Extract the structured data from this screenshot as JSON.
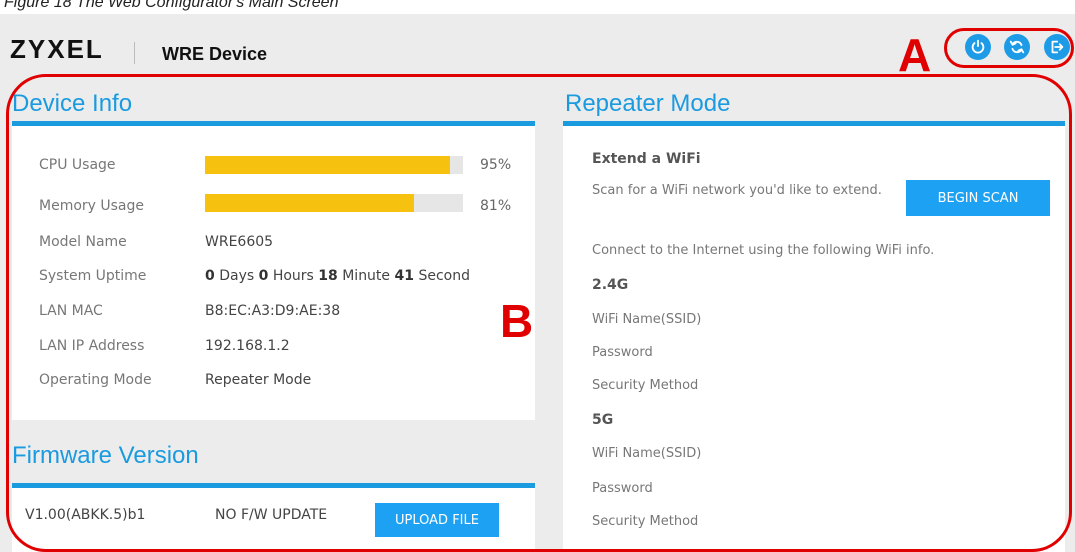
{
  "caption": "Figure 18   The Web Configurator's Main Screen",
  "header": {
    "logo": "ZYXEL",
    "device_title": "WRE Device",
    "icons": [
      "power-icon",
      "refresh-icon",
      "logout-icon"
    ]
  },
  "callouts": {
    "a": "A",
    "b": "B"
  },
  "device_info": {
    "title": "Device Info",
    "cpu": {
      "label": "CPU Usage",
      "value": 0.95,
      "text": "95%"
    },
    "memory": {
      "label": "Memory Usage",
      "value": 0.81,
      "text": "81%"
    },
    "model": {
      "label": "Model Name",
      "value": "WRE6605"
    },
    "uptime": {
      "label": "System Uptime",
      "days": "0",
      "days_unit": "Days",
      "hours": "0",
      "hours_unit": "Hours",
      "minutes": "18",
      "minutes_unit": "Minute",
      "seconds": "41",
      "seconds_unit": "Second"
    },
    "lan_mac": {
      "label": "LAN MAC",
      "value": "B8:EC:A3:D9:AE:38"
    },
    "lan_ip": {
      "label": "LAN IP Address",
      "value": "192.168.1.2"
    },
    "mode": {
      "label": "Operating Mode",
      "value": "Repeater Mode"
    }
  },
  "firmware": {
    "title": "Firmware Version",
    "version": "V1.00(ABKK.5)b1",
    "status": "NO F/W UPDATE",
    "upload_label": "UPLOAD FILE"
  },
  "repeater": {
    "title": "Repeater Mode",
    "extend_heading": "Extend a WiFi",
    "scan_text": "Scan for a WiFi network you'd like to extend.",
    "scan_button": "BEGIN SCAN",
    "connect_text": "Connect to the Internet using the following WiFi info.",
    "band_24": "2.4G",
    "band_5": "5G",
    "ssid_label": "WiFi Name(SSID)",
    "password_label": "Password",
    "security_label": "Security Method"
  },
  "colors": {
    "accent": "#1a9be0",
    "usage_bar": "#f7c20f",
    "callout": "#e00000"
  }
}
